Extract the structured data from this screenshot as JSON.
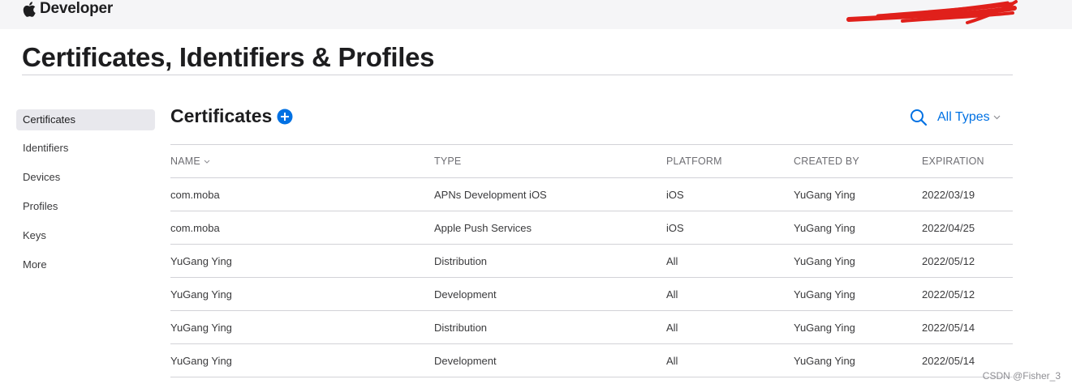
{
  "header": {
    "brand": "Developer",
    "icons": {
      "logo": "apple-icon"
    }
  },
  "page": {
    "title": "Certificates, Identifiers & Profiles"
  },
  "sidebar": {
    "items": [
      {
        "label": "Certificates",
        "active": true
      },
      {
        "label": "Identifiers",
        "active": false
      },
      {
        "label": "Devices",
        "active": false
      },
      {
        "label": "Profiles",
        "active": false
      },
      {
        "label": "Keys",
        "active": false
      },
      {
        "label": "More",
        "active": false
      }
    ]
  },
  "section": {
    "title": "Certificates",
    "add_icon": "plus-circle-icon",
    "search_icon": "search-icon",
    "filter_label": "All Types"
  },
  "table": {
    "columns": [
      "NAME",
      "TYPE",
      "PLATFORM",
      "CREATED BY",
      "EXPIRATION"
    ],
    "rows": [
      [
        "com.moba",
        "APNs Development iOS",
        "iOS",
        "YuGang Ying",
        "2022/03/19"
      ],
      [
        "com.moba",
        "Apple Push Services",
        "iOS",
        "YuGang Ying",
        "2022/04/25"
      ],
      [
        "YuGang Ying",
        "Distribution",
        "All",
        "YuGang Ying",
        "2022/05/12"
      ],
      [
        "YuGang Ying",
        "Development",
        "All",
        "YuGang Ying",
        "2022/05/12"
      ],
      [
        "YuGang Ying",
        "Distribution",
        "All",
        "YuGang Ying",
        "2022/05/14"
      ],
      [
        "YuGang Ying",
        "Development",
        "All",
        "YuGang Ying",
        "2022/05/14"
      ]
    ]
  },
  "watermark": "CSDN @Fisher_3",
  "colors": {
    "accent": "#0071e3",
    "redaction": "#e0201b",
    "topbar_bg": "#f5f5f7",
    "active_item_bg": "#e8e8ed"
  }
}
